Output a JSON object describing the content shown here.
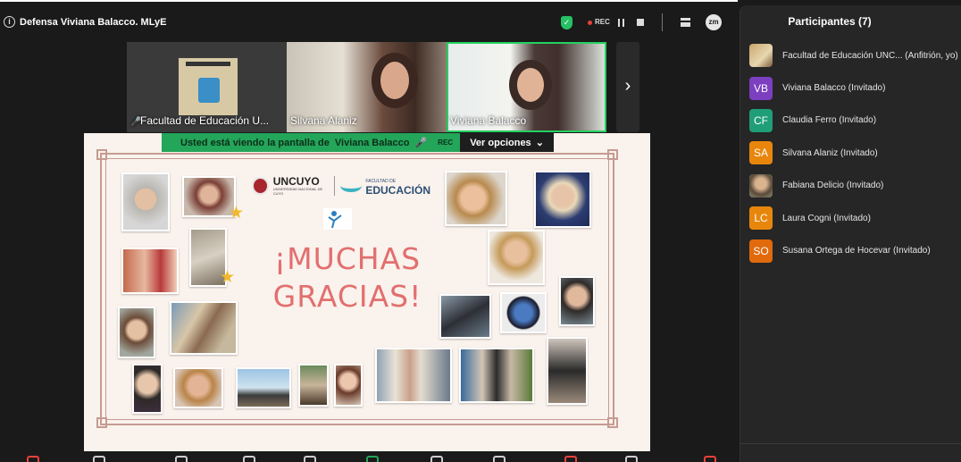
{
  "window": {
    "title": "Defensa Viviana Balacco. MLyE",
    "rec_label": "REC",
    "zoom_badge": "zm"
  },
  "videos": [
    {
      "name": "Facultad de Educación U...",
      "muted": true
    },
    {
      "name": "Silvana Alaniz",
      "muted": false
    },
    {
      "name": "Viviana Balacco",
      "muted": false,
      "active_speaker": true
    }
  ],
  "share_banner": {
    "prefix": "Usted está viendo la pantalla de",
    "presenter": "Viviana Balacco",
    "rec_label": "REC",
    "options_label": "Ver opciones"
  },
  "slide": {
    "uncuyo": "UNCUYO",
    "uncuyo_sub": "UNIVERSIDAD NACIONAL DE CUYO",
    "facultad_line1": "FACULTAD DE",
    "facultad_line2": "EDUCACIÓN",
    "thanks_line1": "¡MUCHAS",
    "thanks_line2": "GRACIAS!"
  },
  "participants": {
    "title": "Participantes (7)",
    "list": [
      {
        "initials": "",
        "name": "Facultad de Educación UNC...   (Anfitrión, yo)",
        "color": "photo"
      },
      {
        "initials": "VB",
        "name": "Viviana Balacco (Invitado)",
        "color": "#7b3fbf"
      },
      {
        "initials": "CF",
        "name": "Claudia Ferro (Invitado)",
        "color": "#1f9e78"
      },
      {
        "initials": "SA",
        "name": "Silvana Alaniz (Invitado)",
        "color": "#e8860c"
      },
      {
        "initials": "",
        "name": "Fabiana Delicio (Invitado)",
        "color": "photo"
      },
      {
        "initials": "LC",
        "name": "Laura Cogni (Invitado)",
        "color": "#e8860c"
      },
      {
        "initials": "SO",
        "name": "Susana Ortega de Hocevar (Invitado)",
        "color": "#e06a0c"
      }
    ]
  }
}
